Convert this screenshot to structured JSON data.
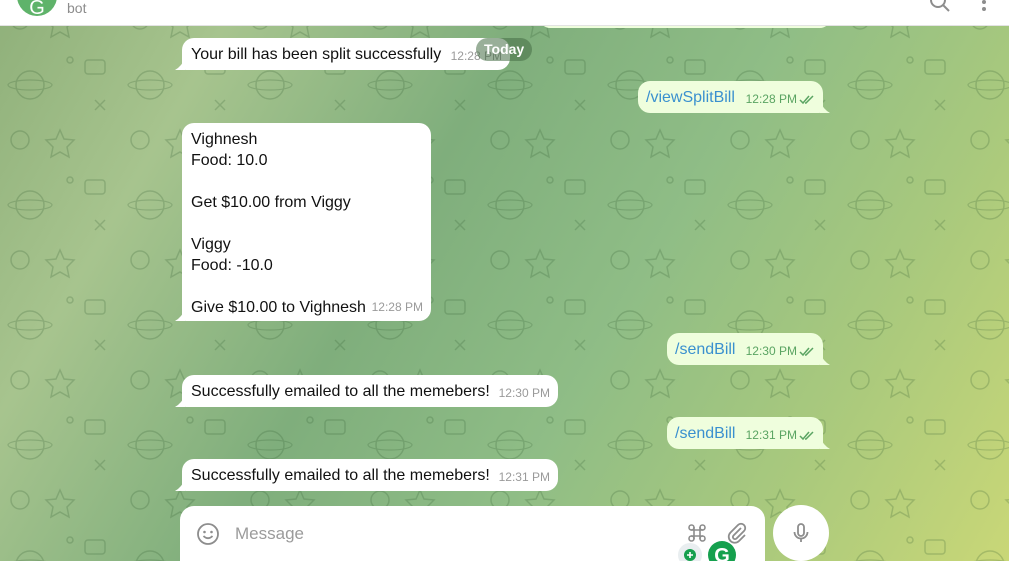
{
  "header": {
    "avatar_initial": "G",
    "subtitle": "bot",
    "icons": [
      "search-icon",
      "more-vertical-icon"
    ]
  },
  "date_chip": "Today",
  "messages": [
    {
      "direction": "in",
      "text": "Your bill has been split successfully",
      "time": "12:28 PM"
    },
    {
      "direction": "out",
      "text": "/viewSplitBill",
      "time": "12:28 PM",
      "status": "read"
    },
    {
      "direction": "in",
      "text": "Vighnesh\nFood: 10.0\n\nGet $10.00 from Viggy\n\nViggy\nFood: -10.0\n\nGive $10.00 to Vighnesh",
      "time": "12:28 PM"
    },
    {
      "direction": "out",
      "text": "/sendBill",
      "time": "12:30 PM",
      "status": "read"
    },
    {
      "direction": "in",
      "text": "Successfully emailed to all the memebers!",
      "time": "12:30 PM"
    },
    {
      "direction": "out",
      "text": "/sendBill",
      "time": "12:31 PM",
      "status": "read"
    },
    {
      "direction": "in",
      "text": "Successfully emailed to all the memebers!",
      "time": "12:31 PM"
    }
  ],
  "composer": {
    "placeholder": "Message",
    "icons": [
      "emoji-icon",
      "command-icon",
      "attach-icon",
      "microphone-icon"
    ]
  },
  "extension_badge": {
    "letter": "G",
    "color": "#15a04e"
  },
  "colors": {
    "incoming_bubble": "#ffffff",
    "outgoing_bubble": "#effedd",
    "command_link": "#3a90cf",
    "read_check": "#5aa462"
  }
}
